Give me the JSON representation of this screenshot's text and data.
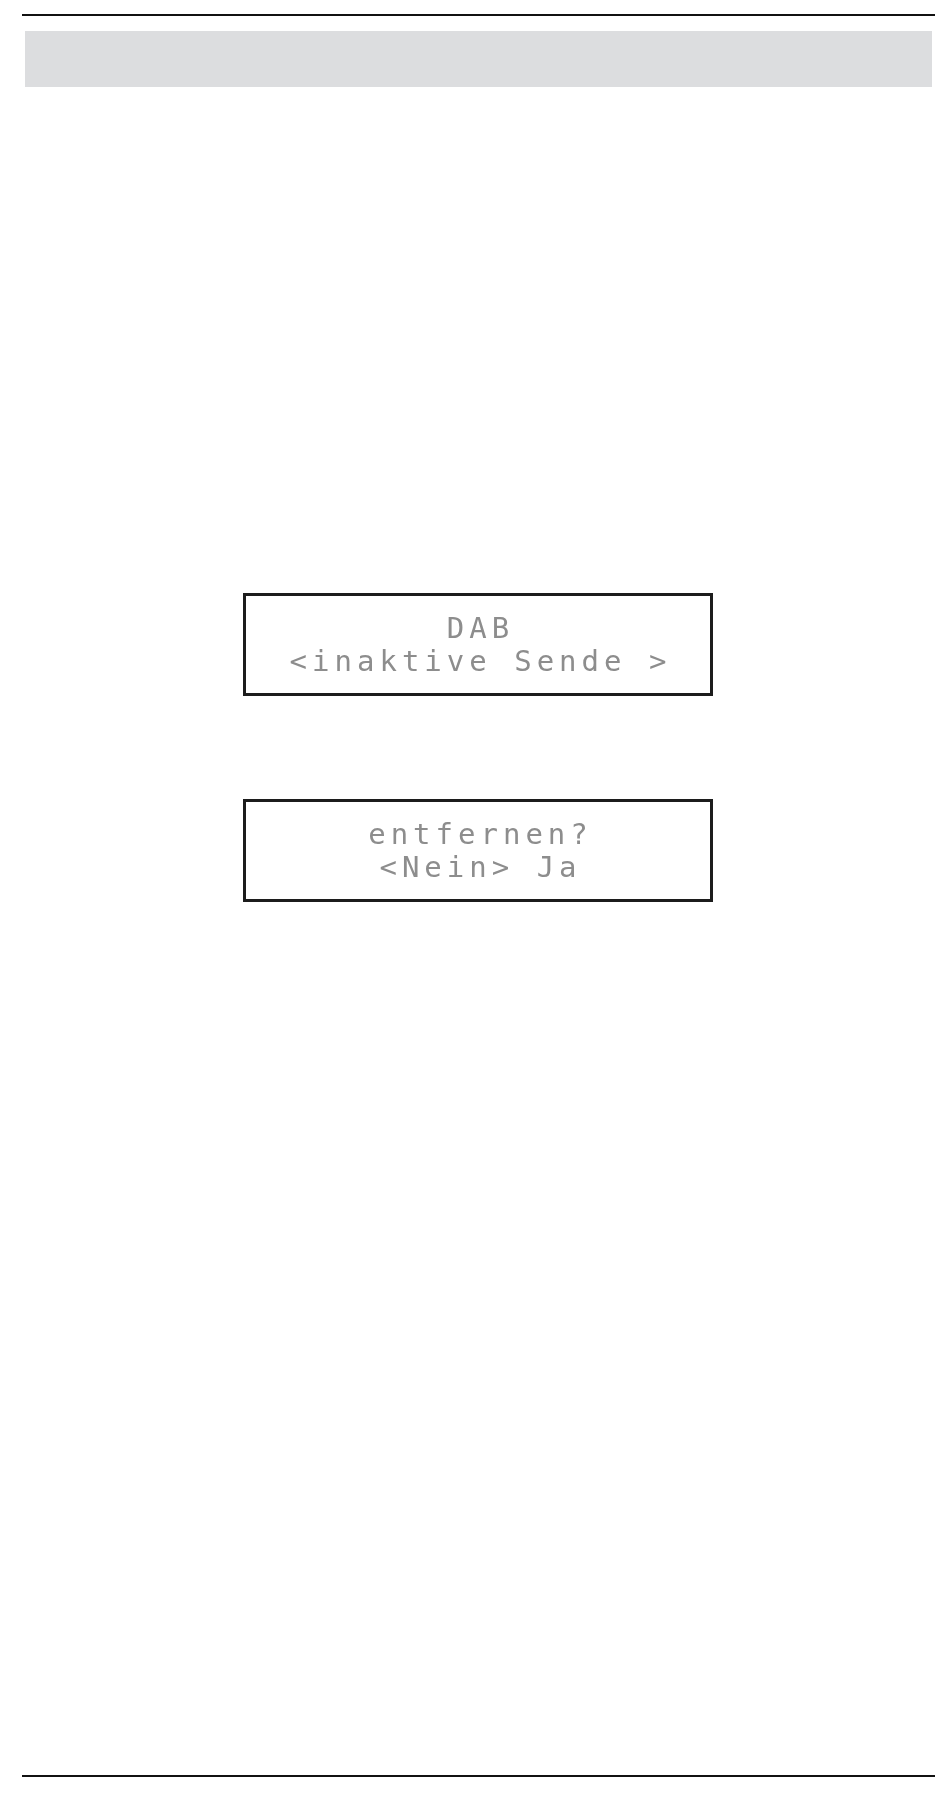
{
  "displays": [
    {
      "lines": [
        "DAB",
        "<inaktive Sende >"
      ]
    },
    {
      "lines": [
        "entfernen?",
        "<Nein> Ja"
      ]
    }
  ]
}
